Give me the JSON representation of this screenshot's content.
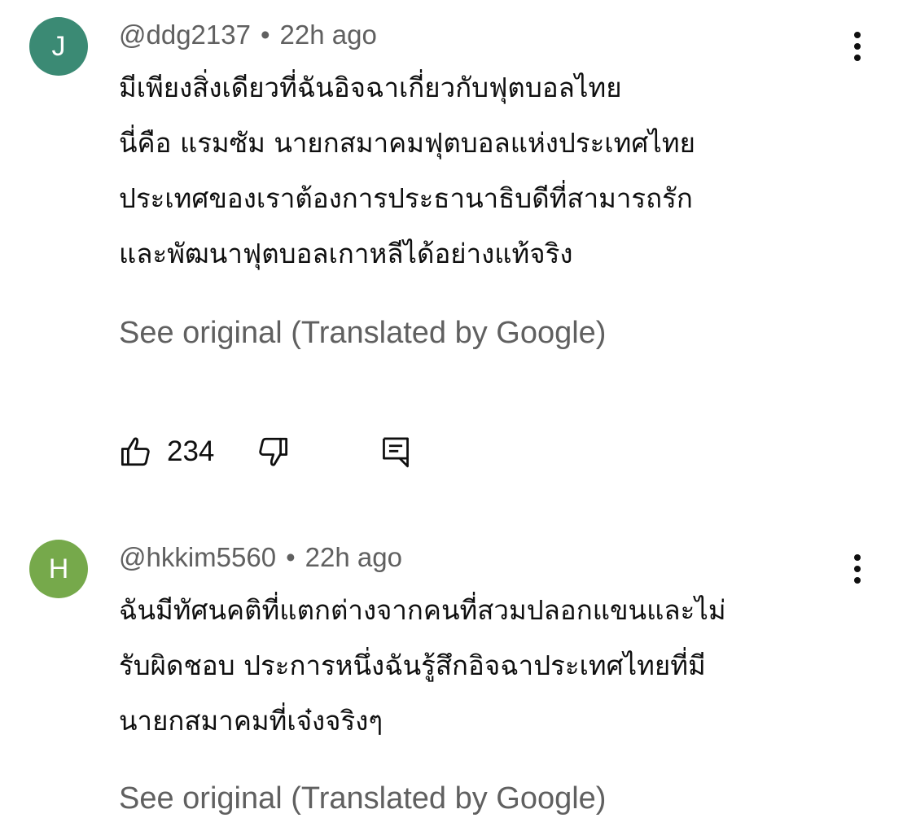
{
  "comments": [
    {
      "avatar_letter": "J",
      "avatar_color": "#3b8a74",
      "handle": "@ddg2137",
      "separator": "•",
      "time": "22h ago",
      "lines": [
        "มีเพียงสิ่งเดียวที่ฉันอิจฉาเกี่ยวกับฟุตบอลไทย",
        "นี่คือ แรมซัม นายกสมาคมฟุตบอลแห่งประเทศไทย",
        "ประเทศของเราต้องการประธานาธิบดีที่สามารถรัก",
        "และพัฒนาฟุตบอลเกาหลีได้อย่างแท้จริง"
      ],
      "see_original": "See original (Translated by Google)",
      "like_count": "234",
      "icons": {
        "more": "more-vert-icon",
        "like": "thumbs-up-icon",
        "dislike": "thumbs-down-icon",
        "reply": "reply-comment-icon"
      }
    },
    {
      "avatar_letter": "H",
      "avatar_color": "#76a94b",
      "handle": "@hkkim5560",
      "separator": "•",
      "time": "22h ago",
      "lines": [
        "ฉันมีทัศนคติที่แตกต่างจากคนที่สวมปลอกแขนและไม่",
        "รับผิดชอบ ประการหนึ่งฉันรู้สึกอิจฉาประเทศไทยที่มี",
        "นายกสมาคมที่เจ๋งจริงๆ"
      ],
      "see_original": "See original (Translated by Google)",
      "icons": {
        "more": "more-vert-icon"
      }
    }
  ]
}
